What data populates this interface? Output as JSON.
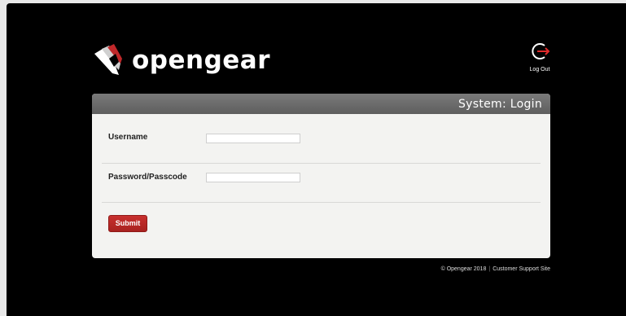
{
  "brand": {
    "name": "opengear"
  },
  "header": {
    "logout_label": "Log Out"
  },
  "panel": {
    "title": "System: Login"
  },
  "form": {
    "username_label": "Username",
    "username_value": "",
    "password_label": "Password/Passcode",
    "password_value": "",
    "submit_label": "Submit"
  },
  "footer": {
    "copyright": "© Opengear 2018",
    "separator": "|",
    "support_link": "Customer Support Site"
  },
  "colors": {
    "background": "#000000",
    "panel": "#f3f3f1",
    "header_bar": "#6b6b6b",
    "accent_red": "#c0282a"
  },
  "icons": {
    "logo": "opengear-logo-icon",
    "logout": "logout-icon"
  }
}
